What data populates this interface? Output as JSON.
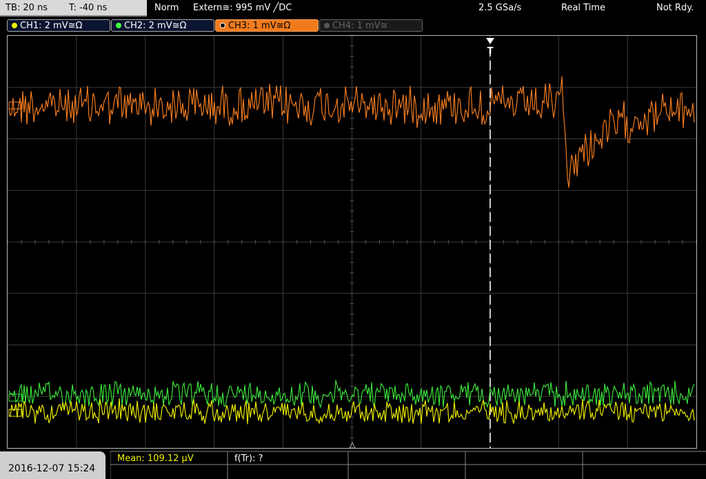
{
  "header": {
    "timebase": "TB: 20 ns",
    "trigger_pos": "T: -40 ns",
    "trigger_mode": "Norm",
    "trigger_source": "Extern≅: 995 mV ╱DC",
    "sample_rate": "2.5 GSa/s",
    "acq_mode": "Real Time",
    "status": "Not Rdy."
  },
  "channels": [
    {
      "label": "CH1: 2 mV≅Ω",
      "color": "#f0f000"
    },
    {
      "label": "CH2: 2 mV≅Ω",
      "color": "#40ff40"
    },
    {
      "label": "CH3: 1 mV≅Ω",
      "color": "#f07b1e"
    },
    {
      "label": "CH4: 1 mV≅",
      "color": "#555555"
    }
  ],
  "trigger_marker": "T",
  "footer": {
    "datetime": "2016-12-07 15:24",
    "mean": "Mean: 109.12 µV",
    "freq": "f(Tr): ?"
  },
  "colors": {
    "ch1": "#e8e800",
    "ch2": "#3ae03a",
    "ch3": "#f07b1e",
    "grid": "#3a3a3a"
  }
}
